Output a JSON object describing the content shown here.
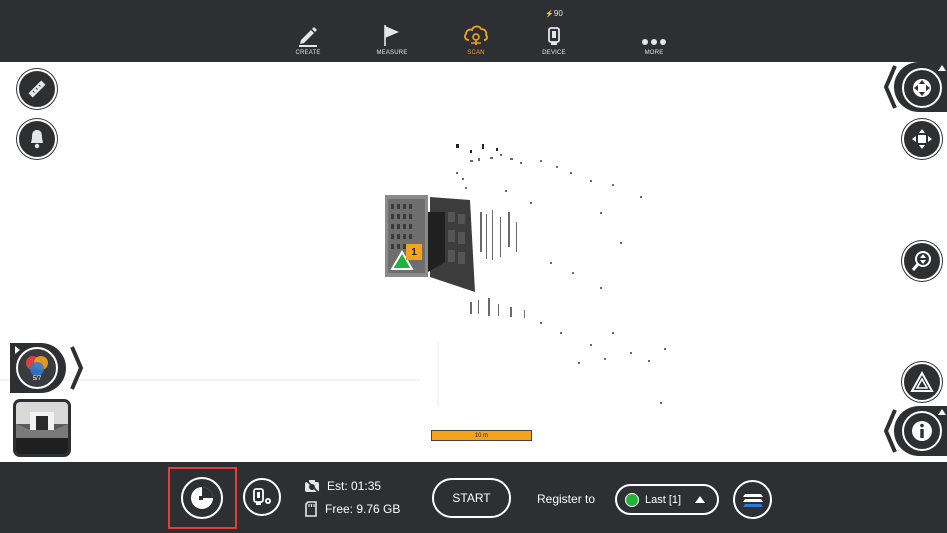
{
  "toolbar": {
    "items": [
      {
        "label": "CREATE",
        "icon": "pencil-icon"
      },
      {
        "label": "MEASURE",
        "icon": "flag-icon"
      },
      {
        "label": "SCAN",
        "icon": "cloud-scan-icon",
        "active": true
      },
      {
        "label": "DEVICE",
        "icon": "scanner-device-icon",
        "battery": "90"
      },
      {
        "label": "MORE",
        "icon": "more-dots-icon"
      }
    ]
  },
  "left_tools": [
    {
      "name": "ruler-icon"
    },
    {
      "name": "bell-icon"
    }
  ],
  "layer_tab": {
    "count": "5/7",
    "icon": "color-layers-icon"
  },
  "right_tools": [
    {
      "name": "pan-navigation-icon"
    },
    {
      "name": "fit-view-icon"
    },
    {
      "name": "zoom-icon"
    },
    {
      "name": "perspective-icon"
    },
    {
      "name": "info-icon"
    }
  ],
  "map": {
    "scan_marker_number": "1",
    "scale_label": "10 m"
  },
  "bottom": {
    "est_label": "Est: 01:35",
    "free_label": "Free: 9.76 GB",
    "start_label": "START",
    "register_label": "Register to",
    "register_value": "Last [1]",
    "register_status_color": "#1db53a"
  },
  "colors": {
    "bar": "#2e2f33",
    "accent": "#f5a31a",
    "highlight": "#e0403a"
  }
}
